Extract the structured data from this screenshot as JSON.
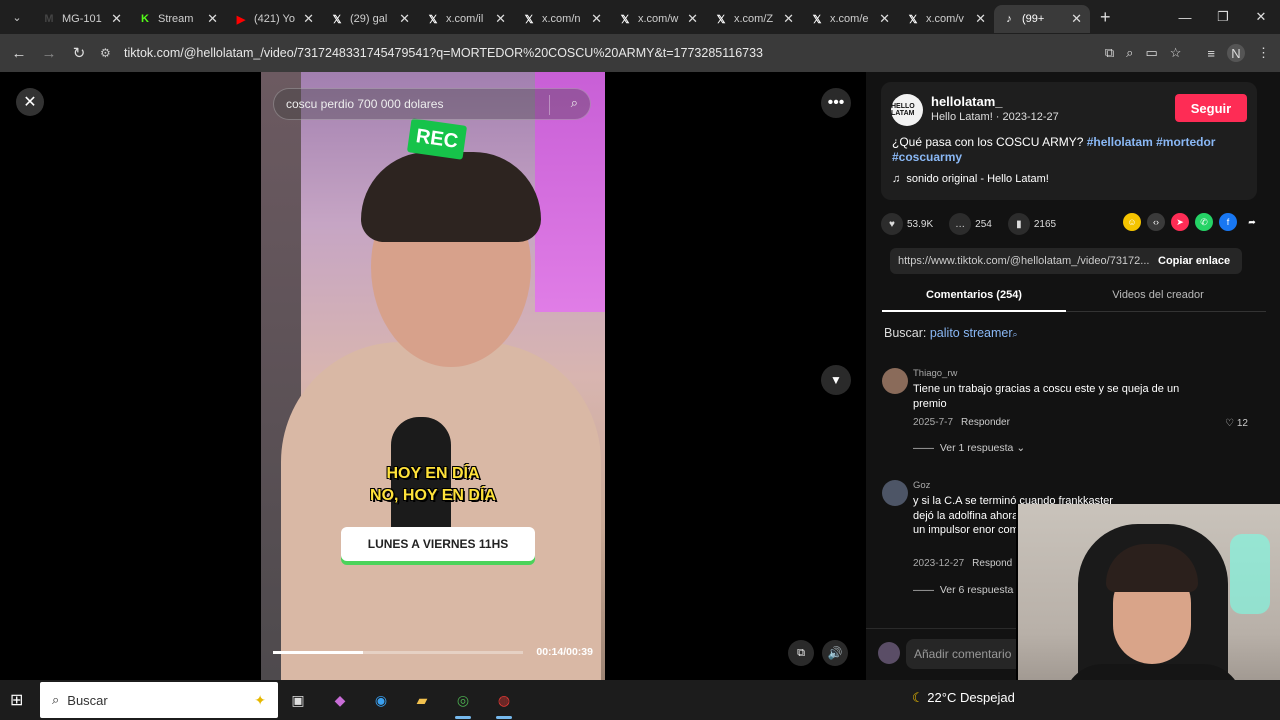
{
  "browser": {
    "tabs": [
      {
        "icon": "gmail-icon",
        "label": "MG-101",
        "color": "#444"
      },
      {
        "icon": "kick-icon",
        "label": "Stream",
        "color": "#53fc18"
      },
      {
        "icon": "youtube-icon",
        "label": "(421) Yo",
        "color": "#ff0000"
      },
      {
        "icon": "x-icon",
        "label": "(29) gal",
        "color": "#fff"
      },
      {
        "icon": "x-icon",
        "label": "x.com/il",
        "color": "#fff"
      },
      {
        "icon": "x-icon",
        "label": "x.com/n",
        "color": "#fff"
      },
      {
        "icon": "x-icon",
        "label": "x.com/w",
        "color": "#fff"
      },
      {
        "icon": "x-icon",
        "label": "x.com/Z",
        "color": "#fff"
      },
      {
        "icon": "x-icon",
        "label": "x.com/e",
        "color": "#fff"
      },
      {
        "icon": "x-icon",
        "label": "x.com/v",
        "color": "#fff"
      },
      {
        "icon": "tiktok-icon",
        "label": "(99+",
        "color": "#fff",
        "active": true
      }
    ],
    "url": "tiktok.com/@hellolatam_/video/7317248331745479541?q=MORTEDOR%20COSCU%20ARMY&t=1773285116733",
    "profile_initial": "N"
  },
  "video": {
    "search_text": "coscu perdio 700 000 dolares",
    "rec_label": "REC",
    "caption_line1": "HOY EN DÍA",
    "caption_line2": "NO, HOY EN DÍA",
    "schedule_label": "LUNES A VIERNES 11HS",
    "time": "00:14/00:39",
    "progress": 0.36
  },
  "author": {
    "avatar_text": "HELLO LATAM",
    "name": "hellolatam_",
    "subtitle": "Hello Latam! · 2023-12-27",
    "follow_label": "Seguir",
    "desc_text": "¿Qué pasa con los COSCU ARMY? ",
    "tags": [
      "#hellolatam",
      "#mortedor",
      "#coscuarmy"
    ],
    "music": "sonido original - Hello Latam!"
  },
  "stats": {
    "likes": "53.9K",
    "comments": "254",
    "saves": "2165"
  },
  "share_colors": [
    "#f5c400",
    "#3a3a3a",
    "#fe2c55",
    "#25d366",
    "#1877f2"
  ],
  "link": {
    "url": "https://www.tiktok.com/@hellolatam_/video/73172...",
    "copy_label": "Copiar enlace"
  },
  "panel_tabs": {
    "comments": "Comentarios (254)",
    "creator": "Videos del creador"
  },
  "search_hint": {
    "label": "Buscar: ",
    "keyword": "palito streamer"
  },
  "comments": [
    {
      "user": "Thiago_rw",
      "text": "Tiene un trabajo gracias a coscu este y se queja de un premio",
      "date": "2025-7-7",
      "reply_label": "Responder",
      "likes": "12",
      "replies": "Ver 1 respuesta"
    },
    {
      "user": "Goz",
      "text": "y si la C.A se terminó cuando frankkaster dejó la adolfina ahora ya solo queda fue un impulsor enor comenzaban",
      "date": "2023-12-27",
      "reply_label": "Respond",
      "likes": "",
      "replies": "Ver 6 respuesta"
    }
  ],
  "comment_input_placeholder": "Añadir comentario",
  "taskbar": {
    "search_placeholder": "Buscar",
    "weather": "22°C  Despejad"
  }
}
